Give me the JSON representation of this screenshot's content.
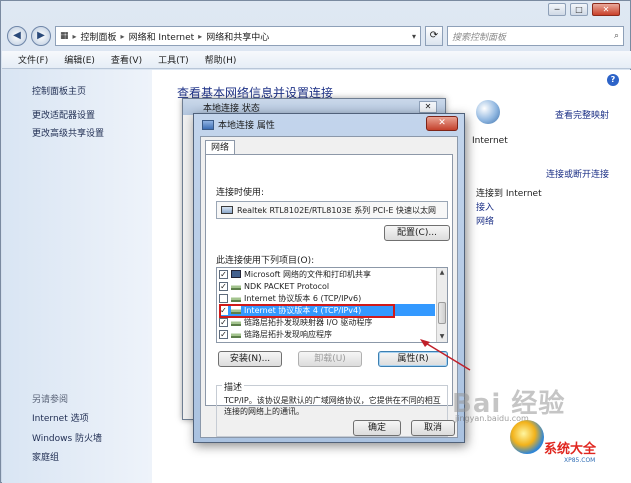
{
  "window": {
    "buttons": [
      "─",
      "□",
      "✕"
    ]
  },
  "address_bar": {
    "crumbs": [
      "控制面板",
      "网络和 Internet",
      "网络和共享中心"
    ],
    "search_placeholder": "搜索控制面板"
  },
  "menu": [
    "文件(F)",
    "编辑(E)",
    "查看(V)",
    "工具(T)",
    "帮助(H)"
  ],
  "left_pane": {
    "items": [
      "控制面板主页",
      "更改适配器设置",
      "更改高级共享设置"
    ],
    "see_also_title": "另请参阅",
    "see_also": [
      "Internet 选项",
      "Windows 防火墙",
      "家庭组"
    ]
  },
  "main": {
    "title": "查看基本网络信息并设置连接",
    "view_full_map": "查看完整映射",
    "internet_label": "Internet",
    "connect_disconnect": "连接或断开连接",
    "access_type": "连接到 Internet",
    "link1": "接入",
    "link2": "网络"
  },
  "bg_dialog": {
    "title": "本地连接 状态"
  },
  "dialog": {
    "title": "本地连接 属性",
    "close": "✕",
    "tab": "网络",
    "connect_using_label": "连接时使用:",
    "adapter": "Realtek RTL8102E/RTL8103E 系列 PCI-E 快速以太网",
    "configure_button": "配置(C)...",
    "items_label": "此连接使用下列项目(O):",
    "items": [
      {
        "checked": true,
        "icon": "svc",
        "label": "Microsoft 网络的文件和打印机共享"
      },
      {
        "checked": true,
        "icon": "net",
        "label": "NDK PACKET Protocol"
      },
      {
        "checked": false,
        "icon": "net",
        "label": "Internet 协议版本 6 (TCP/IPv6)"
      },
      {
        "checked": true,
        "icon": "net",
        "label": "Internet 协议版本 4 (TCP/IPv4)"
      },
      {
        "checked": true,
        "icon": "net",
        "label": "链路层拓扑发现映射器 I/O 驱动程序"
      },
      {
        "checked": true,
        "icon": "net",
        "label": "链路层拓扑发现响应程序"
      }
    ],
    "selected_index": 3,
    "install_button": "安装(N)...",
    "uninstall_button": "卸载(U)",
    "properties_button": "属性(R)",
    "description_label": "描述",
    "description": "TCP/IP。该协议是默认的广域网络协议，它提供在不同的相互连接的网络上的通讯。",
    "ok_button": "确定",
    "cancel_button": "取消"
  },
  "watermark": {
    "text": "Bai 经验",
    "sub": "jingyan.baidu.com",
    "logo_text": "系统大全",
    "logo_url": "XP85.COM"
  }
}
